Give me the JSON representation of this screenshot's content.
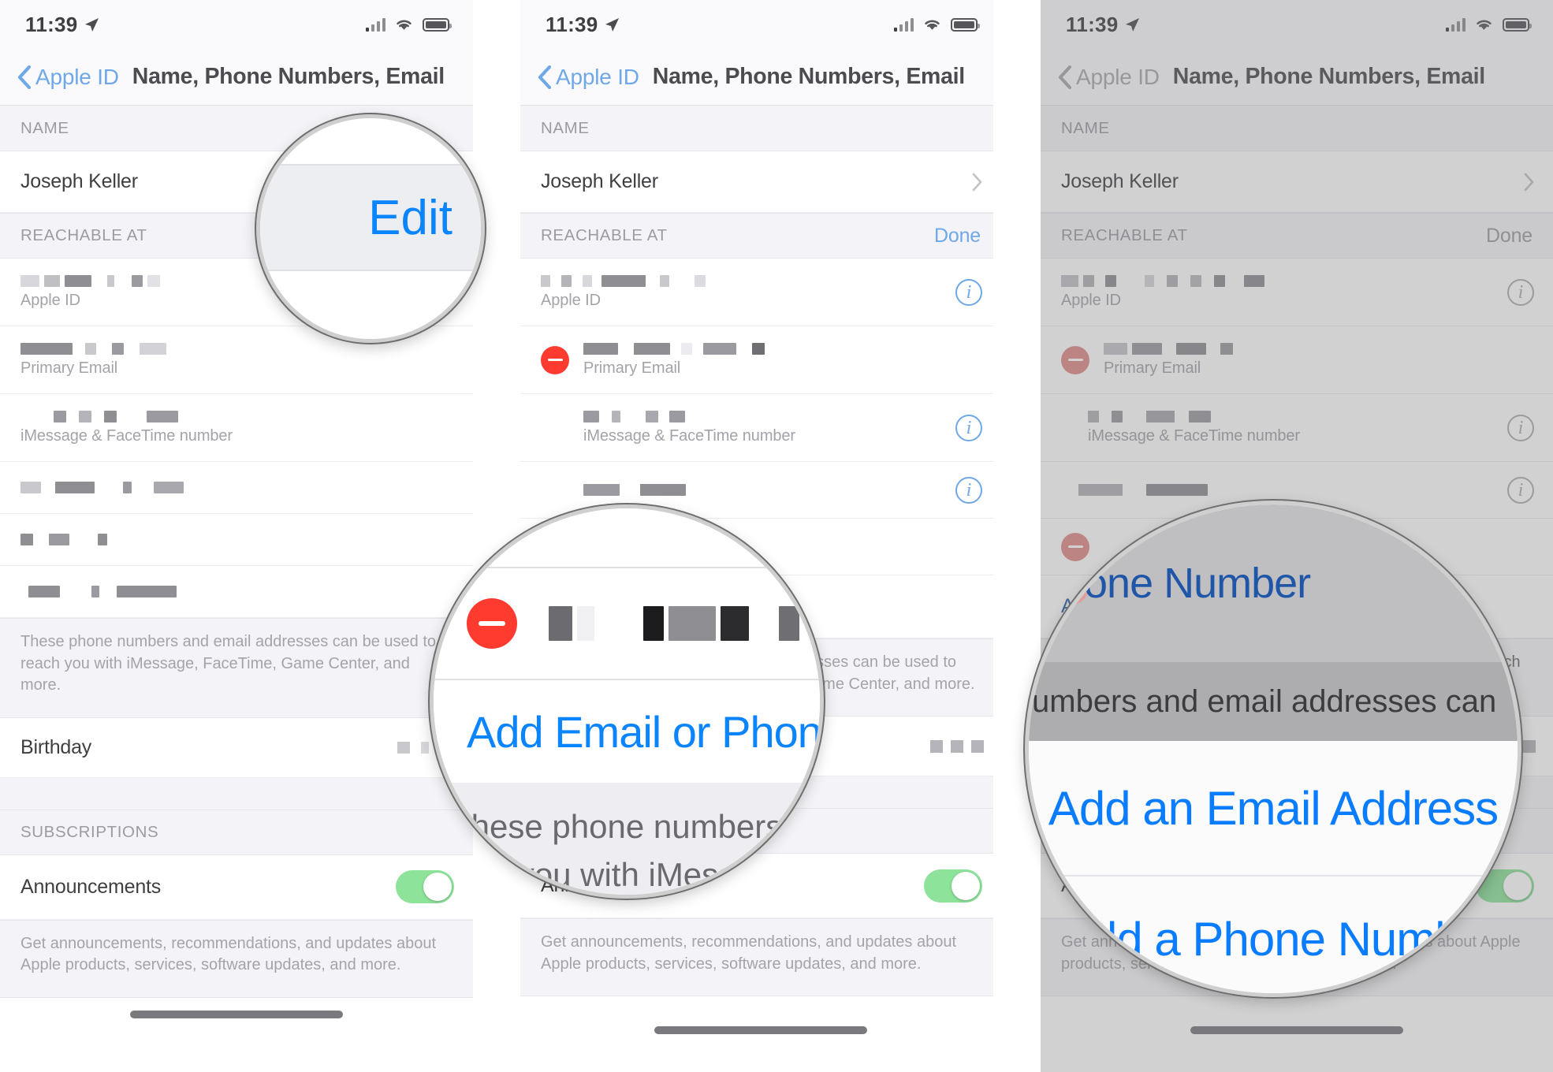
{
  "meta": {
    "accent_blue": "#0a84ff",
    "nav_blue": "#6fa8e8",
    "delete_red": "#ff3b30",
    "toggle_green": "#8de39a",
    "panel_count": 3
  },
  "statusbar": {
    "time": "11:39",
    "location_icon": "location-arrow-icon",
    "signal_icon": "cellular-bars-icon",
    "wifi_icon": "wifi-icon",
    "battery_icon": "battery-icon"
  },
  "navbar": {
    "back_icon": "chevron-left-icon",
    "back_label": "Apple ID",
    "title": "Name, Phone Numbers, Email"
  },
  "sections": {
    "name_header": "NAME",
    "reachable_header": "REACHABLE AT",
    "subscriptions_header": "SUBSCRIPTIONS",
    "edit_label": "Edit",
    "done_label": "Done"
  },
  "rows": {
    "person_name": "Joseph Keller",
    "birthday_label": "Birthday",
    "announcements_label": "Announcements",
    "add_row_label": "Add Email or Phone Number"
  },
  "contacts": [
    {
      "sub": "Apple ID"
    },
    {
      "sub": "Primary Email"
    },
    {
      "sub": "iMessage & FaceTime number"
    },
    {
      "sub": ""
    },
    {
      "sub": ""
    },
    {
      "sub": ""
    }
  ],
  "footnotes": {
    "reachable": "These phone numbers and email addresses can be used to reach you with iMessage, FaceTime, Game Center, and more.",
    "announcements": "Get announcements, recommendations, and updates about Apple products, services, software updates, and more."
  },
  "magnifiers": {
    "panel1": {
      "text": "Edit"
    },
    "panel2": {
      "link": "Add Email or Phone Nu",
      "note_line1": "These phone numbers an",
      "note_line2": "each you with iMessag"
    },
    "panel3": {
      "partial_link": "one Number",
      "note": "umbers and email addresses can",
      "action_email": "Add an Email Address",
      "action_phone": "Add a Phone Numbe"
    }
  }
}
